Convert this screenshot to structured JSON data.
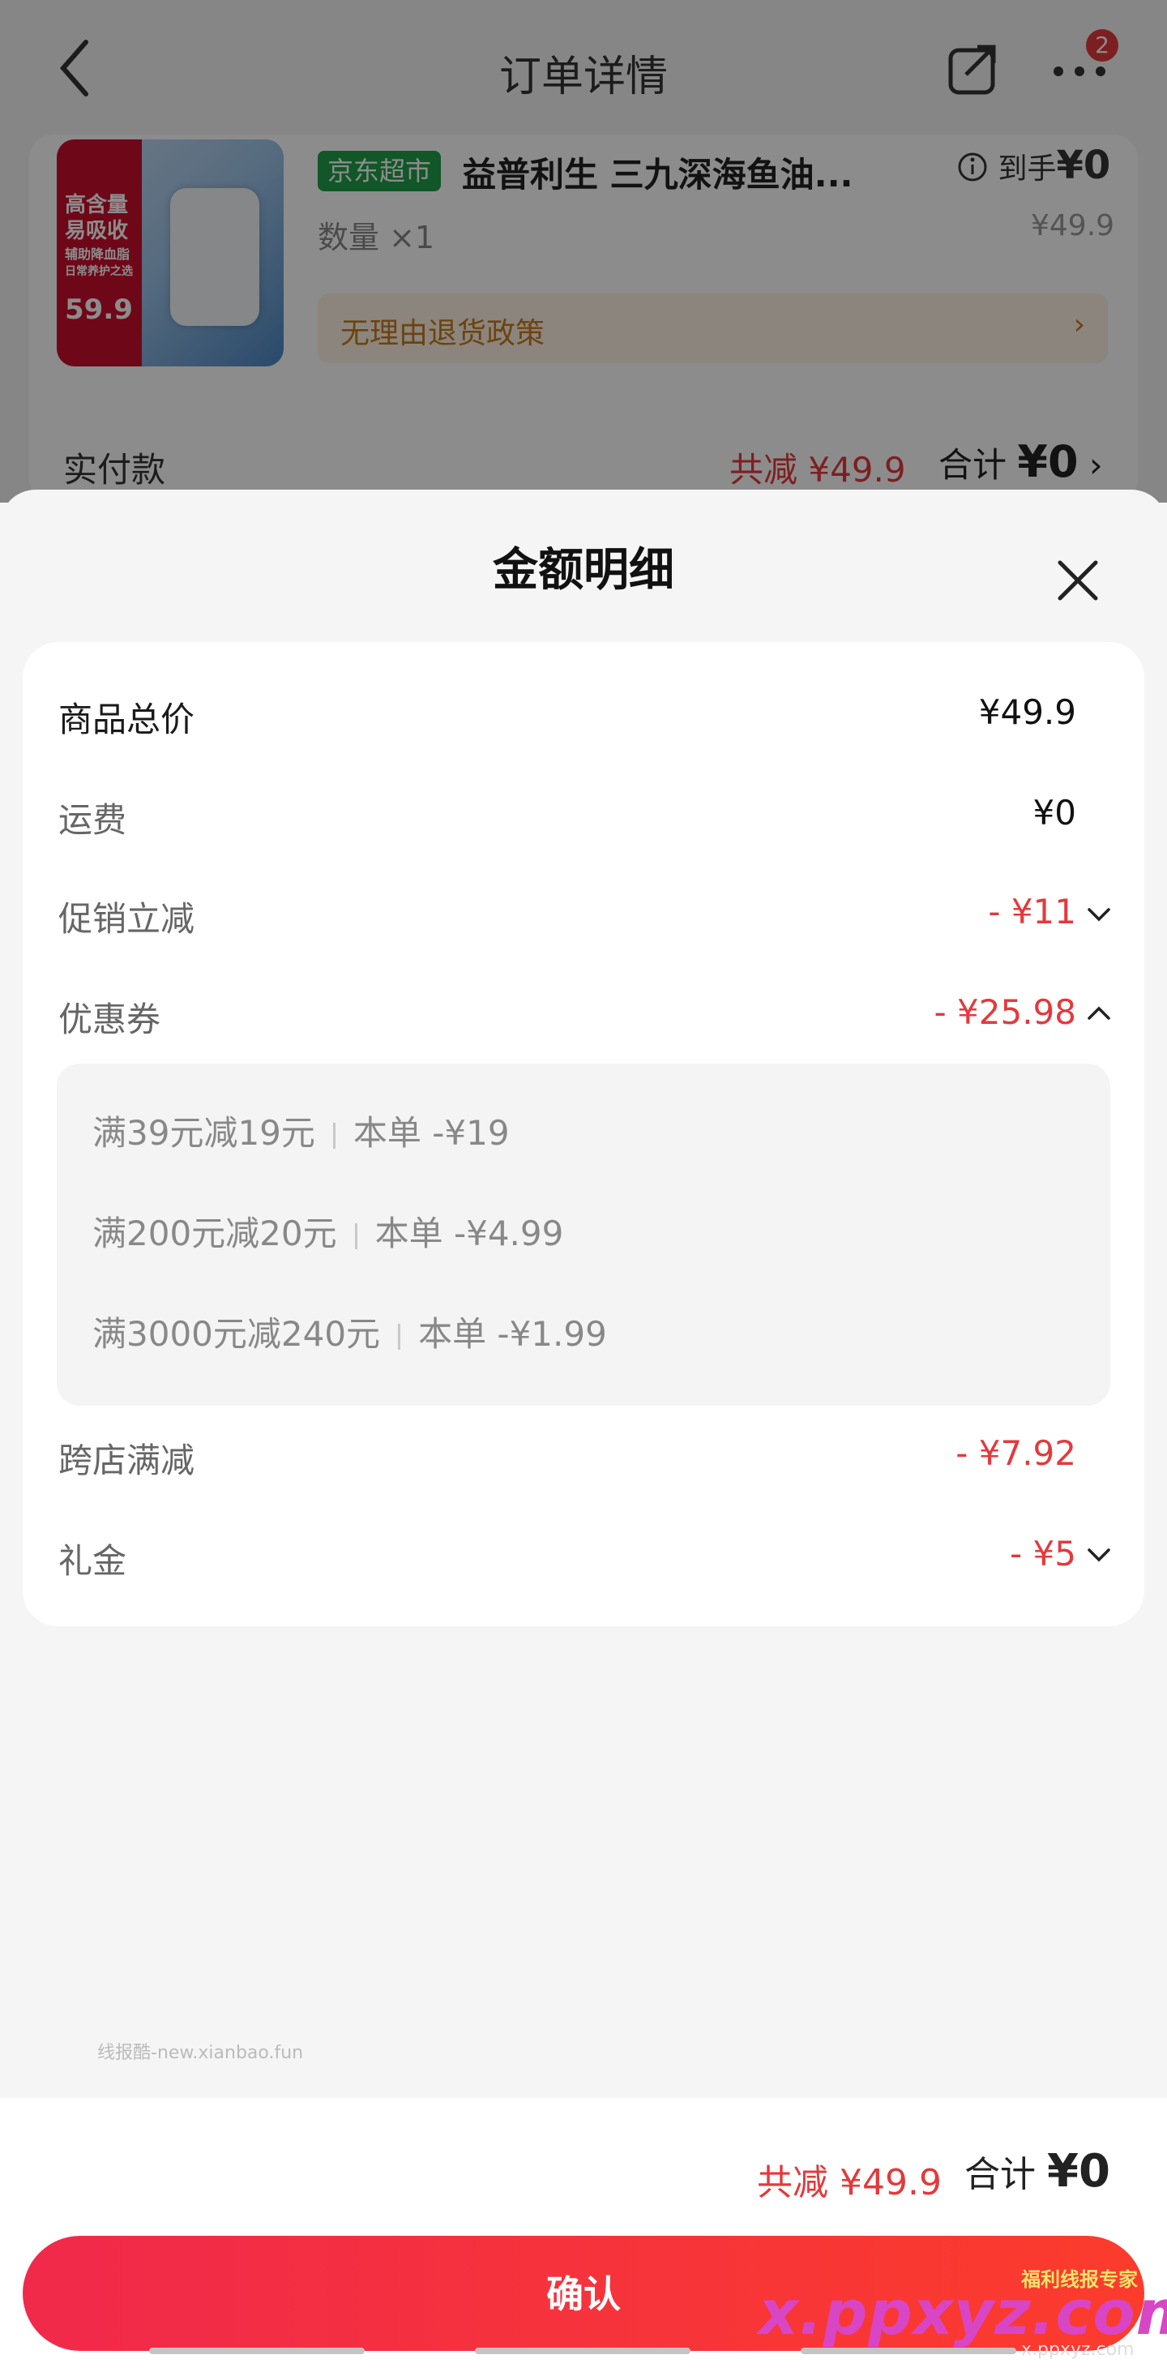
{
  "nav": {
    "title": "订单详情",
    "badge_count": "2"
  },
  "product": {
    "store_tag": "京东超市",
    "title": "益普利生 三九深海鱼油...",
    "quantity": "数量 ×1",
    "dao_shou_label": "到手",
    "dao_shou_price": "¥0",
    "price": "¥49.9",
    "return_policy": "无理由退货政策",
    "thumb_lines": [
      "高含量",
      "易吸收",
      "辅助降血脂",
      "日常养护之选",
      "59.9"
    ]
  },
  "paid_row": {
    "label": "实付款",
    "reduce": "共减 ¥49.9",
    "total_label": "合计",
    "total_value": "¥0"
  },
  "sheet": {
    "title": "金额明细",
    "rows": [
      {
        "label": "商品总价",
        "value": "¥49.9"
      },
      {
        "label": "运费",
        "value": "¥0"
      },
      {
        "label": "促销立减",
        "value": "- ¥11"
      },
      {
        "label": "优惠券",
        "value": "- ¥25.98"
      },
      {
        "label": "跨店满减",
        "value": "- ¥7.92"
      },
      {
        "label": "礼金",
        "value": "- ¥5"
      }
    ],
    "coupons": [
      {
        "rule": "满39元减19元",
        "detail": "本单 -¥19"
      },
      {
        "rule": "满200元减20元",
        "detail": "本单 -¥4.99"
      },
      {
        "rule": "满3000元减240元",
        "detail": "本单 -¥1.99"
      }
    ],
    "watermark": "线报酷-new.xianbao.fun"
  },
  "bottom": {
    "reduce": "共减 ¥49.9",
    "total_label": "合计",
    "total_value": "¥0",
    "confirm_label": "确认",
    "watermark_main": "x.ppxyz.com",
    "watermark_sub": "福利线报专家",
    "watermark_url": "x.ppxyz.com"
  },
  "colors": {
    "accent_red": "#e4393c",
    "store_green": "#1f9e4a",
    "return_orange": "#c77a1e"
  }
}
